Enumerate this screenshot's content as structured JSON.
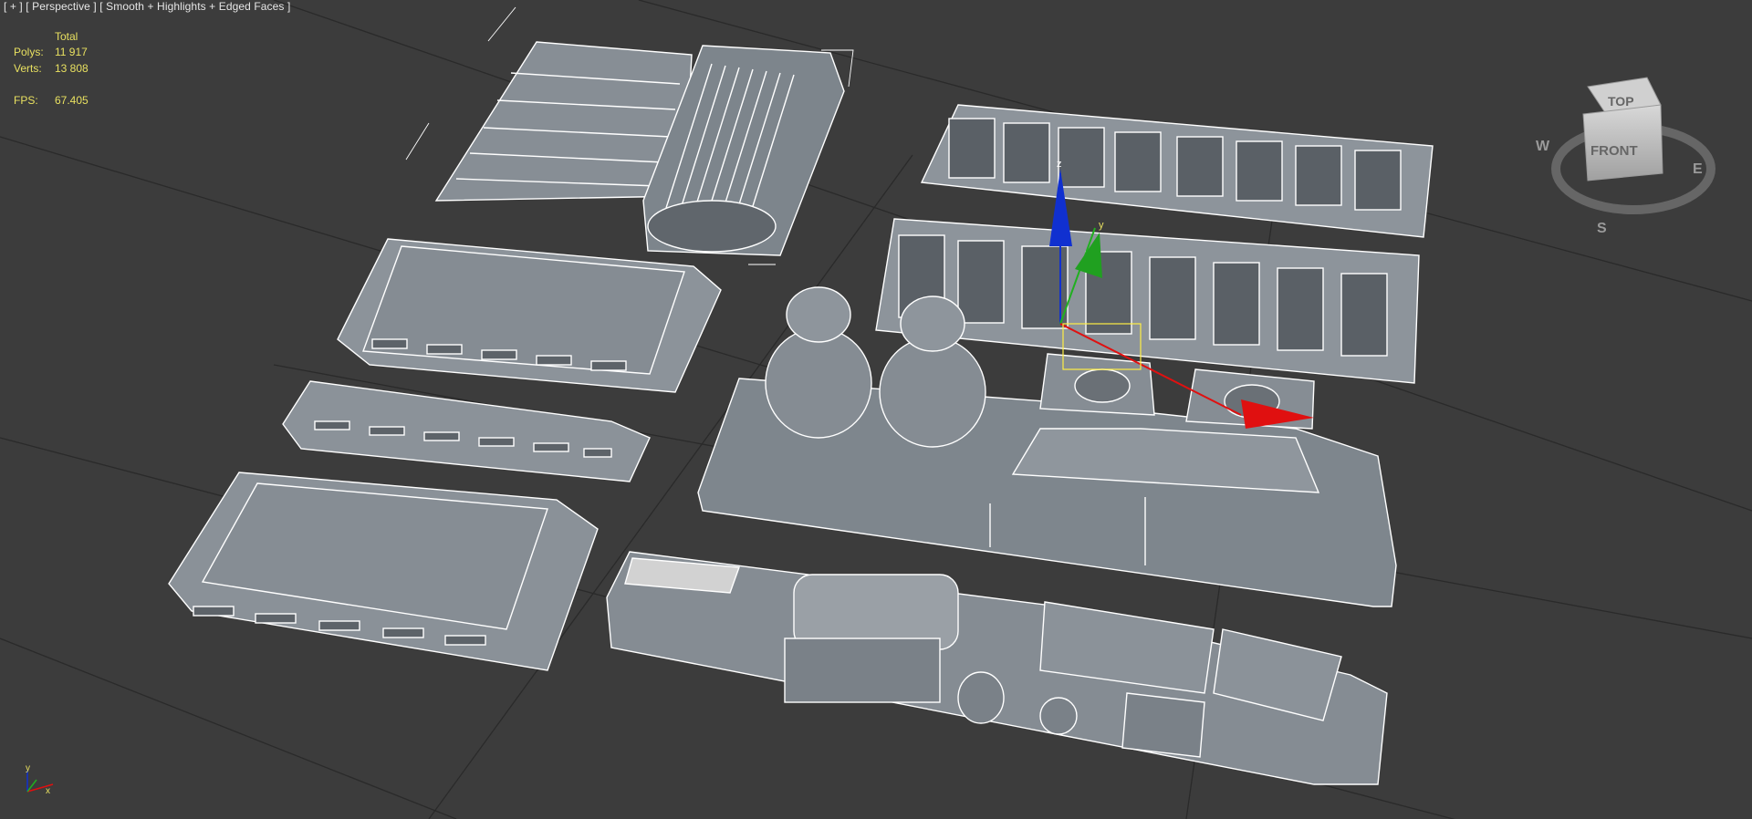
{
  "viewport": {
    "menu_plus": "[ + ]",
    "view_name": "[ Perspective ]",
    "shading_mode": "[ Smooth + Highlights + Edged Faces ]"
  },
  "stats": {
    "column_header": "Total",
    "polys_label": "Polys:",
    "polys_value": "11 917",
    "verts_label": "Verts:",
    "verts_value": "13 808",
    "fps_label": "FPS:",
    "fps_value": "67.405"
  },
  "viewcube": {
    "top_label": "TOP",
    "front_label": "FRONT",
    "compass_w": "W",
    "compass_e": "E",
    "compass_s": "S"
  },
  "gizmo": {
    "z_label": "z",
    "y_label": "y"
  },
  "axis_tripod": {
    "y_label": "y",
    "x_label": "x"
  },
  "colors": {
    "background": "#3c3c3c",
    "grid": "#2a2a2a",
    "mesh_fill": "#8a9198",
    "mesh_edge": "#ffffff",
    "stats_text": "#e8e060",
    "gizmo_x": "#e01010",
    "gizmo_y": "#20b020",
    "gizmo_z": "#1030d0"
  }
}
